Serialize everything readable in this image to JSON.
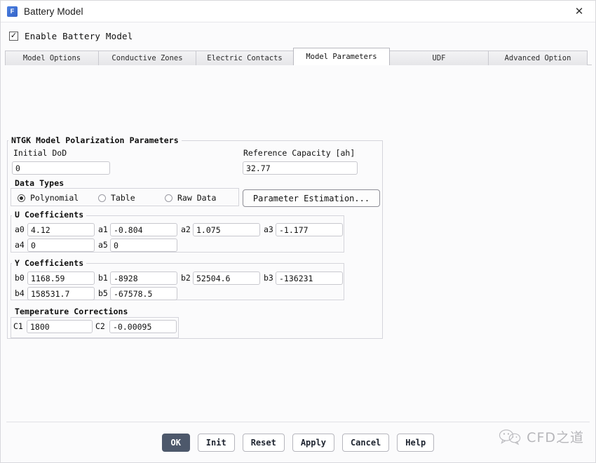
{
  "window": {
    "title": "Battery Model",
    "icon": "fluent-f-icon",
    "close_icon": "close-icon"
  },
  "enable": {
    "label": "Enable Battery Model",
    "checked": true,
    "check_glyph": "✓"
  },
  "tabs": [
    {
      "label": "Model Options",
      "active": false
    },
    {
      "label": "Conductive Zones",
      "active": false
    },
    {
      "label": "Electric Contacts",
      "active": false
    },
    {
      "label": "Model Parameters",
      "active": true
    },
    {
      "label": "UDF",
      "active": false
    },
    {
      "label": "Advanced Option",
      "active": false
    }
  ],
  "panel": {
    "title": "NTGK Model Polarization Parameters",
    "initial_dod": {
      "label": "Initial DoD",
      "value": "0"
    },
    "reference_capacity": {
      "label": "Reference Capacity [ah]",
      "value": "32.77"
    },
    "data_types": {
      "title": "Data Types",
      "options": [
        {
          "label": "Polynomial",
          "selected": true
        },
        {
          "label": "Table",
          "selected": false
        },
        {
          "label": "Raw Data",
          "selected": false
        }
      ]
    },
    "parameter_estimation_button": "Parameter Estimation...",
    "u_coefficients": {
      "title": "U Coefficients",
      "fields": [
        {
          "label": "a0",
          "value": "4.12"
        },
        {
          "label": "a1",
          "value": "-0.804"
        },
        {
          "label": "a2",
          "value": "1.075"
        },
        {
          "label": "a3",
          "value": "-1.177"
        },
        {
          "label": "a4",
          "value": "0"
        },
        {
          "label": "a5",
          "value": "0"
        }
      ]
    },
    "y_coefficients": {
      "title": "Y Coefficients",
      "fields": [
        {
          "label": "b0",
          "value": "1168.59"
        },
        {
          "label": "b1",
          "value": "-8928"
        },
        {
          "label": "b2",
          "value": "52504.6"
        },
        {
          "label": "b3",
          "value": "-136231"
        },
        {
          "label": "b4",
          "value": "158531.7"
        },
        {
          "label": "b5",
          "value": "-67578.5"
        }
      ]
    },
    "temperature_corrections": {
      "title": "Temperature Corrections",
      "fields": [
        {
          "label": "C1",
          "value": "1800"
        },
        {
          "label": "C2",
          "value": "-0.00095"
        }
      ]
    }
  },
  "footer": {
    "buttons": [
      {
        "label": "OK",
        "primary": true
      },
      {
        "label": "Init",
        "primary": false
      },
      {
        "label": "Reset",
        "primary": false
      },
      {
        "label": "Apply",
        "primary": false
      },
      {
        "label": "Cancel",
        "primary": false
      },
      {
        "label": "Help",
        "primary": false
      }
    ]
  },
  "watermark": {
    "text": "CFD之道",
    "icon": "wechat-logo-icon"
  },
  "colors": {
    "accent": "#4d586b",
    "app_icon": "#3564c8",
    "window_bg": "#fbfbfc",
    "tab_active_bg": "#ffffff",
    "border": "#d5d5db"
  }
}
